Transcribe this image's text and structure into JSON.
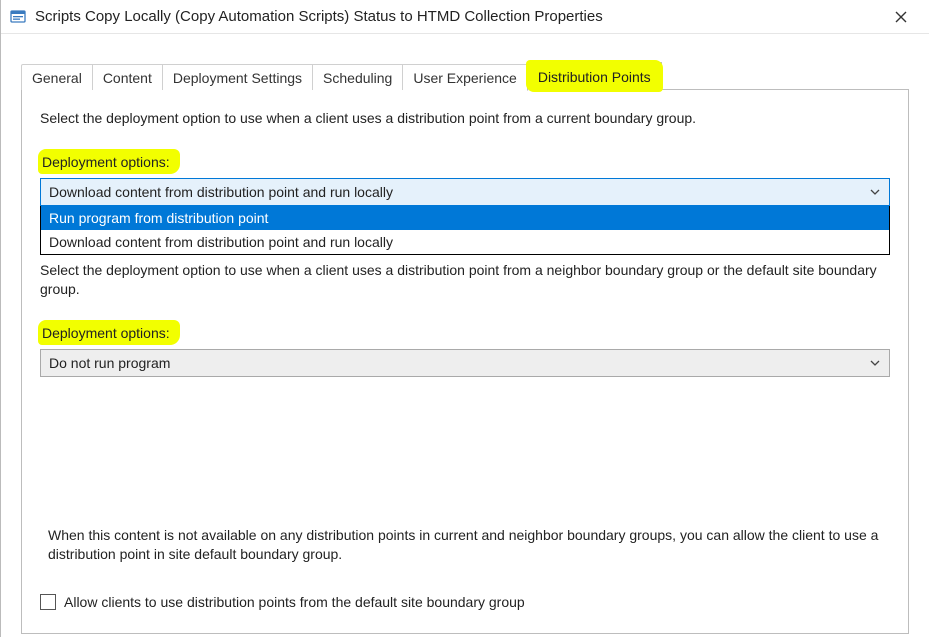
{
  "window": {
    "title": "Scripts Copy Locally (Copy Automation Scripts) Status to HTMD Collection Properties"
  },
  "tabs": {
    "general": "General",
    "content": "Content",
    "deployment_settings": "Deployment Settings",
    "scheduling": "Scheduling",
    "user_experience": "User Experience",
    "distribution_points": "Distribution Points"
  },
  "section1": {
    "desc": "Select the deployment option to use when a client uses a distribution point from a current boundary group.",
    "label": "Deployment options:",
    "combo_value": "Download content from distribution point and run locally",
    "option_highlighted": "Run program from distribution point",
    "option_other": "Download content from distribution point and run locally"
  },
  "section2": {
    "desc": "Select the deployment option to use when a client uses a distribution point from a neighbor boundary group or the default site boundary group.",
    "label": "Deployment options:",
    "combo_value": "Do not run program"
  },
  "lower": {
    "desc": "When this content is not available on any distribution points in current and neighbor boundary groups, you can allow the client to use a distribution point in site default boundary group.",
    "checkbox_label": "Allow clients to use distribution points from the default site boundary group"
  }
}
